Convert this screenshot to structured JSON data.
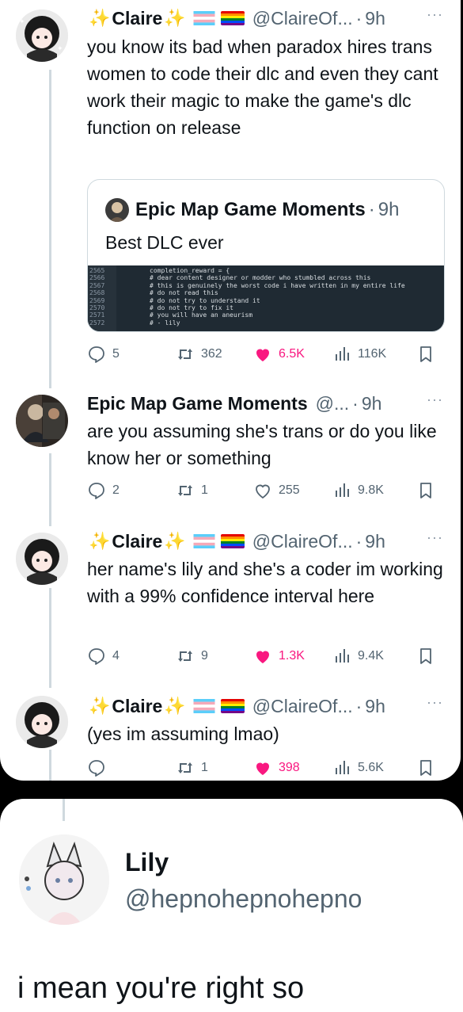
{
  "tweets": [
    {
      "name": "Claire",
      "handle": "@ClaireOf...",
      "time": "9h",
      "text": "you know its bad when paradox hires trans women to code their dlc and even they cant work their magic to make the game's dlc function on release",
      "quote": {
        "name": "Epic Map Game Moments",
        "time": "9h",
        "text": "Best DLC ever",
        "code_gutter": [
          "2565",
          "2566",
          "2567",
          "2568",
          "2569",
          "2570",
          "2571",
          "2572"
        ],
        "code_lines": [
          "completion_reward = {",
          "# dear content designer or modder who stumbled across this",
          "# this is genuinely the worst code i have written in my entire life",
          "# do not read this",
          "# do not try to understand it",
          "# do not try to fix it",
          "# you will have an aneurism",
          "# - lily"
        ]
      },
      "replies": "5",
      "retweets": "362",
      "likes": "6.5K",
      "views": "116K",
      "liked": true
    },
    {
      "name": "Epic Map Game Moments",
      "handle": "@...",
      "time": "9h",
      "text": "are you assuming she's trans or do you like know her or something",
      "replies": "2",
      "retweets": "1",
      "likes": "255",
      "views": "9.8K",
      "liked": false
    },
    {
      "name": "Claire",
      "handle": "@ClaireOf...",
      "time": "9h",
      "text": "her name's lily and she's a coder im working with a 99% confidence interval here",
      "replies": "4",
      "retweets": "9",
      "likes": "1.3K",
      "views": "9.4K",
      "liked": true
    },
    {
      "name": "Claire",
      "handle": "@ClaireOf...",
      "time": "9h",
      "text": "(yes im assuming lmao)",
      "replies": "",
      "retweets": "1",
      "likes": "398",
      "views": "5.6K",
      "liked": true
    }
  ],
  "lily": {
    "name": "Lily",
    "handle": "@hepnohepnohepno",
    "text": "i mean you're right so"
  },
  "colors": {
    "like_pink": "#f91880",
    "muted": "#536471",
    "border": "#cfd9de",
    "sparkle": "#f5c518"
  },
  "icons": [
    "reply-icon",
    "retweet-icon",
    "like-icon",
    "views-icon",
    "bookmark-icon",
    "more-icon",
    "sparkle-icon",
    "trans-flag-icon",
    "pride-flag-icon"
  ]
}
